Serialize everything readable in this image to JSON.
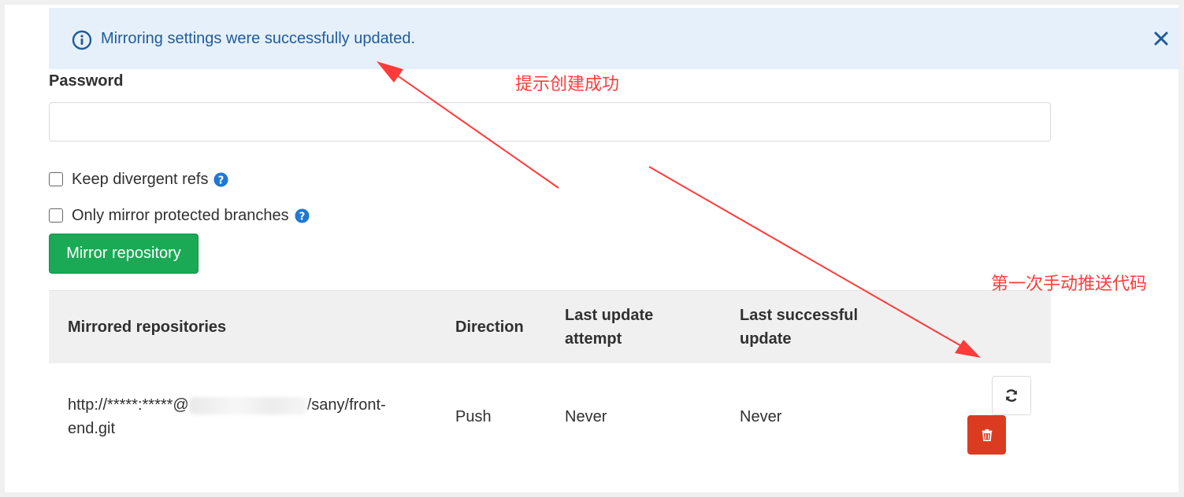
{
  "flash": {
    "message": "Mirroring settings were successfully updated.",
    "info_icon": "info-circle-icon",
    "close_icon": "close-icon"
  },
  "form": {
    "password_label": "Password",
    "password_value": "",
    "keep_divergent_label": "Keep divergent refs",
    "only_protected_label": "Only mirror protected branches",
    "help_icon": "question-circle-icon",
    "submit_label": "Mirror repository"
  },
  "table": {
    "headers": {
      "repo": "Mirrored repositories",
      "direction": "Direction",
      "last_attempt_1": "Last update",
      "last_attempt_2": "attempt",
      "last_success_1": "Last successful",
      "last_success_2": "update"
    },
    "rows": [
      {
        "url_prefix": "http://*****:*****@",
        "url_suffix": "/sany/front-",
        "url_line2": "end.git",
        "direction": "Push",
        "last_attempt": "Never",
        "last_success": "Never",
        "sync_icon": "sync-icon",
        "delete_icon": "trash-icon"
      }
    ]
  },
  "annotations": {
    "success_note": "提示创建成功",
    "push_note": "第一次手动推送代码"
  },
  "colors": {
    "flash_bg": "#e6f0fb",
    "flash_text": "#1f5c99",
    "primary_green": "#1aaa55",
    "danger_red": "#db3b21",
    "help_blue": "#1f78d1",
    "annotation_red": "#ff3b3b"
  }
}
